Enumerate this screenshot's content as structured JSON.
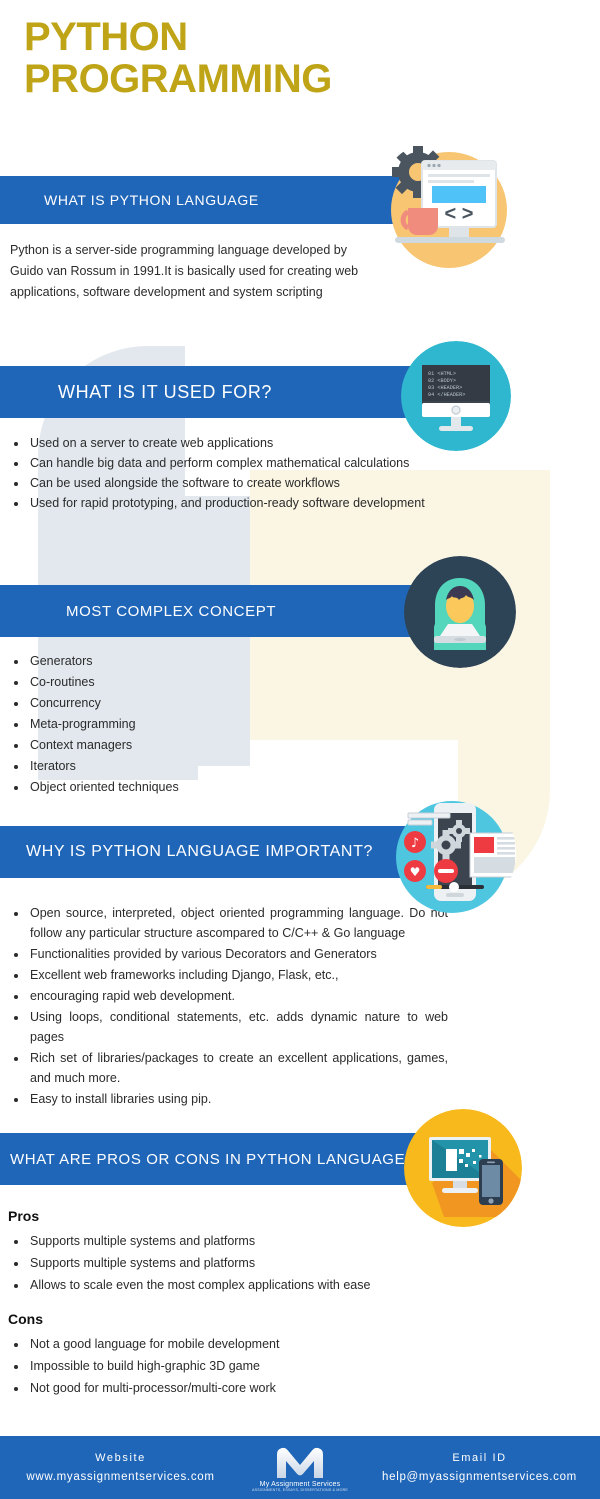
{
  "title": {
    "line1": "PYTHON",
    "line2": "PROGRAMMING",
    "color": "#bfa417"
  },
  "theme": {
    "banner_blue": "#2066b8",
    "footer_blue": "#2066b8",
    "teal": "#2fb7cf",
    "amber": "#f6b93b",
    "orange": "#f7a81b",
    "dark_navy": "#2d4356",
    "watermark_grey": "#e3e8ee",
    "watermark_cream": "#fbf6e4"
  },
  "sections": [
    {
      "id": "what-is-python-language",
      "banner": "WHAT IS PYTHON LANGUAGE",
      "icon": "monitor-code-gear-icon",
      "paragraph": "Python is a server-side programming language developed by Guido van Rossum in 1991.It is basically used for creating web applications, software development and system scripting"
    },
    {
      "id": "what-is-it-used-for",
      "banner": "WHAT IS IT USED  FOR?",
      "icon": "desktop-html-code-icon",
      "bullets": [
        "Used on a server to create web applications",
        "Can handle big data and perform complex mathematical calculations",
        "Can be used alongside the software to create workflows",
        "Used for rapid prototyping, and production-ready software development"
      ]
    },
    {
      "id": "most-complex-concept",
      "banner": "MOST COMPLEX CONCEPT",
      "icon": "hooded-developer-laptop-icon",
      "bullets": [
        "Generators",
        "Co-routines",
        "Concurrency",
        "Meta-programming",
        "Context managers",
        "Iterators",
        "Object oriented techniques"
      ]
    },
    {
      "id": "why-is-python-language-important",
      "banner": "WHY IS PYTHON LANGUAGE IMPORTANT?",
      "icon": "mobile-app-media-icon",
      "bullets": [
        "Open source, interpreted, object oriented programming language. Do not follow any particular structure ascompared to C/C++ & Go language",
        "Functionalities provided by various Decorators and Generators",
        "Excellent web frameworks including Django, Flask, etc.,",
        "encouraging rapid web development.",
        "Using loops, conditional statements, etc. adds dynamic nature to web pages",
        "Rich set of libraries/packages to create an excellent applications, games, and much more.",
        "Easy to install libraries using pip."
      ]
    },
    {
      "id": "pros-or-cons",
      "banner": "WHAT ARE PROS OR CONS IN PYTHON LANGUAGE",
      "icon": "desktop-mobile-responsive-icon",
      "pros_heading": "Pros",
      "pros": [
        "Supports multiple systems and platforms",
        "Supports multiple systems and platforms",
        "Allows to scale even the most complex applications with ease"
      ],
      "cons_heading": "Cons",
      "cons": [
        "Not a good language for mobile development",
        "Impossible to build high-graphic 3D game",
        "Not good for multi-processor/multi-core work"
      ]
    }
  ],
  "icon_code_lines": [
    "01  <HTML>",
    "02  <BODY>",
    "03  <HEADER>",
    "04  </HEADER>"
  ],
  "footer": {
    "website_label": "Website",
    "website_value": "www.myassignmentservices.com",
    "logo_name": "My Assignment Services",
    "logo_tagline": "ASSIGNMENTS, ESSAYS, DISSERTATIONS & MORE",
    "email_label": "Email ID",
    "email_value": "help@myassignmentservices.com"
  }
}
